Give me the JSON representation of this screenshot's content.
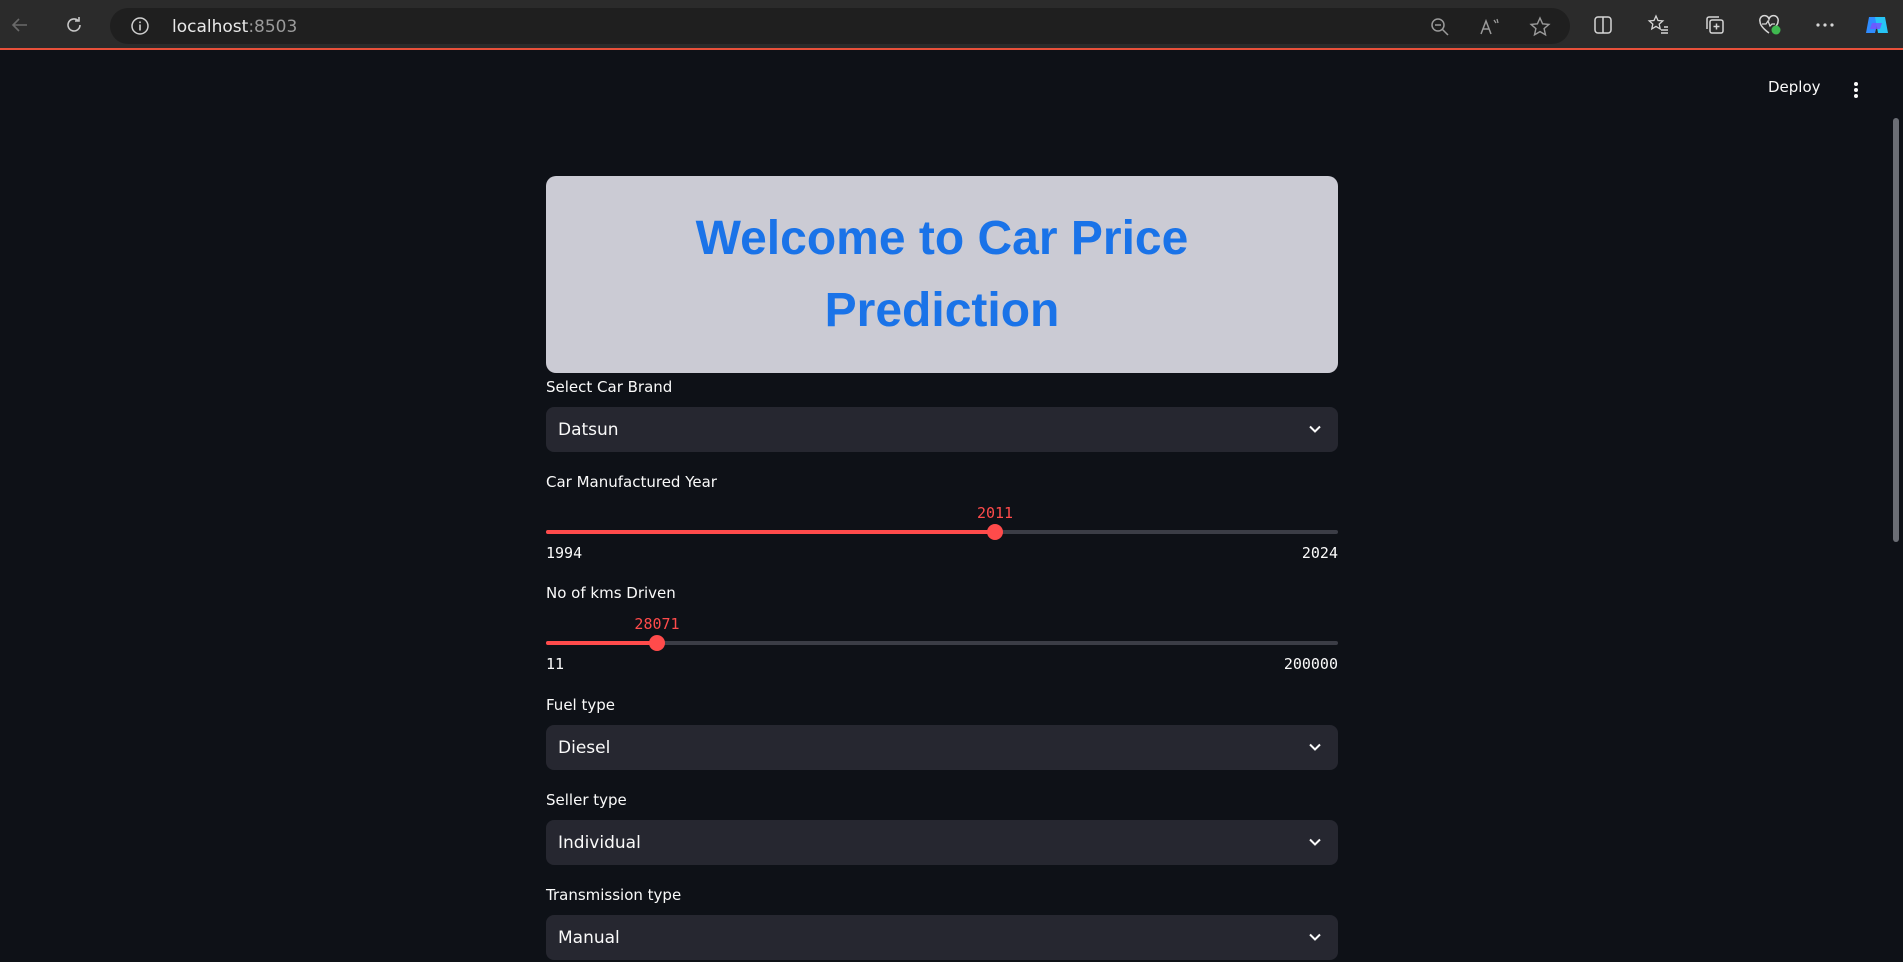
{
  "browser": {
    "url_host": "localhost",
    "url_port": ":8503"
  },
  "toolbar": {
    "deploy_label": "Deploy"
  },
  "banner": {
    "title": "Welcome to Car Price Prediction"
  },
  "form": {
    "brand": {
      "label": "Select Car Brand",
      "value": "Datsun"
    },
    "year": {
      "label": "Car Manufactured Year",
      "value": "2011",
      "min": "1994",
      "max": "2024"
    },
    "kms": {
      "label": "No of kms Driven",
      "value": "28071",
      "min": "11",
      "max": "200000"
    },
    "fuel": {
      "label": "Fuel type",
      "value": "Diesel"
    },
    "seller": {
      "label": "Seller type",
      "value": "Individual"
    },
    "transmission": {
      "label": "Transmission type",
      "value": "Manual"
    }
  },
  "colors": {
    "accent": "#ff4b4b",
    "title": "#1a73e8",
    "banner_bg": "#cbcbd4",
    "page_bg": "#0e1117"
  }
}
